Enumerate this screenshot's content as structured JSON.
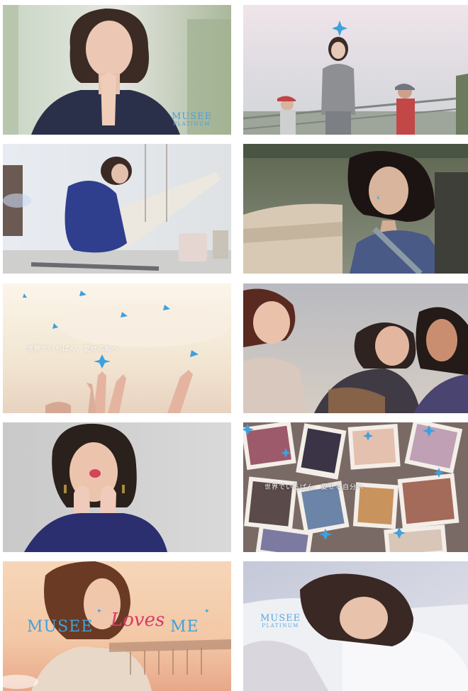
{
  "frames": [
    {
      "name": "frame-praying-woman",
      "logo": {
        "line1": "MUSEE",
        "line2": "PLATINUM"
      }
    },
    {
      "name": "frame-bridge-walk"
    },
    {
      "name": "frame-painting"
    },
    {
      "name": "frame-car-window"
    },
    {
      "name": "frame-sky-hands",
      "text": "世界でいちばん、愛せる私へ"
    },
    {
      "name": "frame-friends-laughing"
    },
    {
      "name": "frame-blowing-kiss"
    },
    {
      "name": "frame-photo-collage",
      "text": "世界でいちばん、愛せる自分へ"
    },
    {
      "name": "frame-musee-loves-me",
      "logo": {
        "word1": "MUSEE",
        "word2": "Loves",
        "word3": "ME",
        "star": "✦"
      }
    },
    {
      "name": "frame-sleeping",
      "logo": {
        "line1": "MUSEE",
        "line2": "PLATINUM"
      }
    }
  ],
  "colors": {
    "accent_blue": "#4aa3e0",
    "accent_pink": "#d83a68"
  },
  "icons": {
    "sparkle": "sparkle-icon"
  }
}
